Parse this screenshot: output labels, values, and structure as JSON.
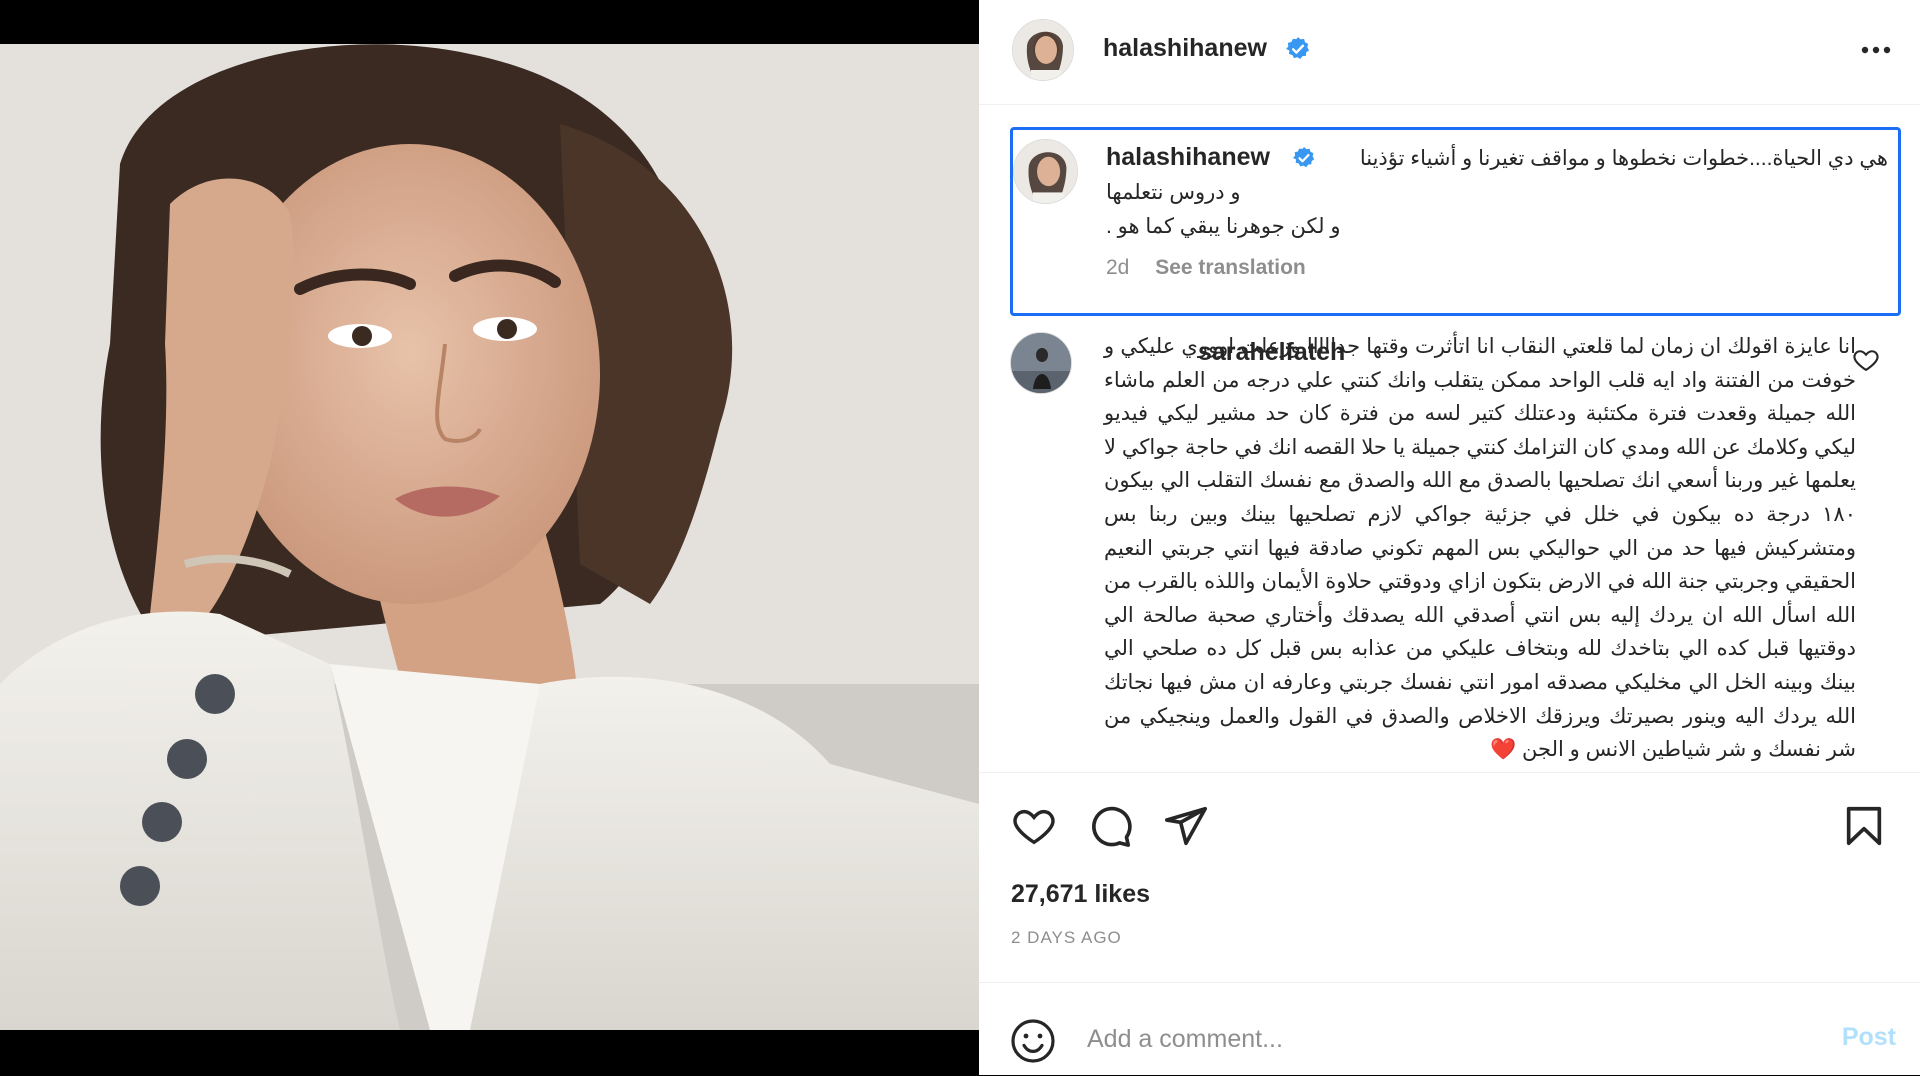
{
  "header": {
    "username": "halashihanew",
    "verified_icon": "verified-badge-icon",
    "more_icon": "more-options-icon"
  },
  "caption": {
    "username": "halashihanew",
    "line1": "هي دي الحياة....خطوات نخطوها و مواقف تغيرنا و أشياء تؤذينا",
    "line2": "و دروس نتعلمها",
    "line3": "و لكن جوهرنا يبقي كما هو .",
    "time": "2d",
    "see_translation": "See translation"
  },
  "comment": {
    "username": "sarahelfateh",
    "text": "انا عايزة اقولك ان زمان لما قلعتي النقاب انا اتأثرت وقتها جدااااا وزعلت اوووي عليكي و خوفت من الفتنة واد ايه قلب الواحد ممكن يتقلب وانك كنتي علي درجه من العلم ماشاء الله جميلة وقعدت فترة مكتئبة ودعتلك كتير لسه من فترة كان حد مشير ليكي فيديو ليكي وكلامك عن الله ومدي كان التزامك كنتي جميلة يا حلا القصه انك في حاجة جواكي لا يعلمها غير وربنا أسعي انك تصلحيها بالصدق مع الله والصدق مع نفسك التقلب الي بيكون ١٨٠ درجة ده بيكون في خلل في جزئية جواكي لازم تصلحيها بينك وبين ربنا بس ومتشركيش فيها حد من الي حواليكي بس المهم تكوني صادقة فيها انتي جربتي النعيم الحقيقي وجربتي جنة الله في الارض بتكون ازاي ودوقتي حلاوة الأيمان واللذه بالقرب من الله اسأل الله ان يردك إليه بس انتي أصدقي الله يصدقك وأختاري صحبة صالحة الي دوقتيها قبل كده الي بتاخدك لله وبتخاف عليكي من عذابه بس قبل كل ده صلحي الي بينك وبينه الخل الي مخليكي مصدقه امور انتي نفسك جربتي وعارفه ان مش فيها نجاتك الله يردك اليه وينور بصيرتك ويرزقك الاخلاص والصدق في القول والعمل وينجيكي من شر نفسك و شر شياطين الانس و الجن ❤️",
    "like_icon": "heart-outline-icon"
  },
  "actions": {
    "like_icon": "heart-icon",
    "comment_icon": "comment-icon",
    "share_icon": "share-icon",
    "save_icon": "bookmark-icon",
    "likes_text": "27,671 likes",
    "date_text": "2 DAYS AGO"
  },
  "comment_bar": {
    "emoji_icon": "emoji-icon",
    "placeholder": "Add a comment...",
    "post_label": "Post"
  },
  "colors": {
    "focus_border": "#1b6ef3",
    "verified": "#3897f0",
    "post_disabled": "#b2dffc"
  }
}
